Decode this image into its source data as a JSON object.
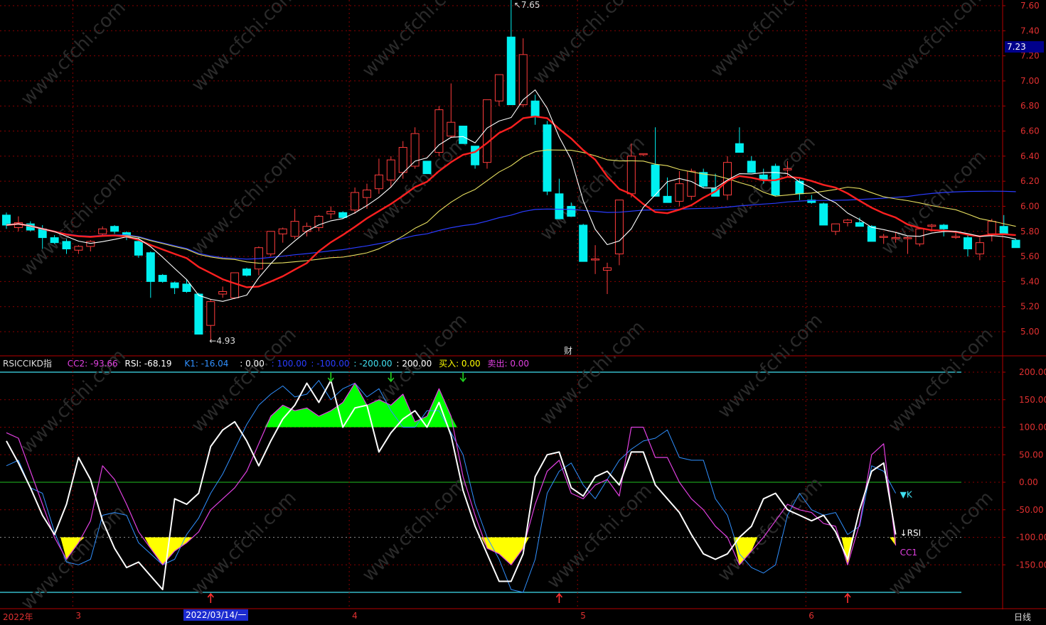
{
  "colors": {
    "up": "#ff3c3c",
    "down": "#00f0f0",
    "frame": "#b40000",
    "grid": "#8a0000",
    "ma_white": "#ffffff",
    "ma_red": "#ff2020",
    "ma_yellow": "#e8e060",
    "ma_blue": "#2a3cff",
    "cc_line": "#e040e0",
    "rsi_line": "#ffffff",
    "k_line": "#3090ff",
    "fill_green": "#00ff00",
    "fill_yellow": "#ffff00",
    "ref_cyan": "#40e0f0",
    "ref_green": "#20c020"
  },
  "header": {
    "indicator_name": "RSICCIKD指",
    "cc2": "CC2: -93.66",
    "rsi": "RSI: -68.19",
    "k1": "K1: -16.04",
    "v0": ": 0.00",
    "v100": ": 100.00",
    "vm100": ": -100.00",
    "vm200": ": -200.00",
    "v200": ": 200.00",
    "buy": "买入: 0.00",
    "sell": "卖出: 0.00"
  },
  "price_tag": "7.23",
  "timeframe": "日线",
  "selected_date": "2022/03/14/一",
  "fin_marker": "财",
  "line_labels": {
    "k": "▼K",
    "rsi": "↓RSI",
    "cc1": "CC1"
  },
  "extremes": {
    "high_label": "7.65",
    "low_label": "←4.93"
  },
  "chart_data": [
    {
      "type": "candlestick",
      "title": "",
      "ylim": [
        4.8,
        7.65
      ],
      "ytick_labels": [
        "7.60",
        "7.40",
        "7.20",
        "7.00",
        "6.80",
        "6.60",
        "6.40",
        "6.20",
        "6.00",
        "5.80",
        "5.60",
        "5.40",
        "5.20",
        "5.00"
      ],
      "ytick_values": [
        7.6,
        7.4,
        7.2,
        7.0,
        6.8,
        6.6,
        6.4,
        6.2,
        6.0,
        5.8,
        5.6,
        5.4,
        5.2,
        5.0
      ],
      "x_labels": [
        {
          "index": 0,
          "label": "2022年"
        },
        {
          "index": 6,
          "label": "3"
        },
        {
          "index": 29,
          "label": "4"
        },
        {
          "index": 48,
          "label": "5"
        },
        {
          "index": 67,
          "label": "6"
        }
      ],
      "ohlc": [
        [
          5.93,
          5.95,
          5.82,
          5.85
        ],
        [
          5.83,
          5.92,
          5.8,
          5.87
        ],
        [
          5.86,
          5.88,
          5.8,
          5.81
        ],
        [
          5.82,
          5.85,
          5.66,
          5.75
        ],
        [
          5.75,
          5.77,
          5.7,
          5.71
        ],
        [
          5.72,
          5.74,
          5.62,
          5.66
        ],
        [
          5.65,
          5.69,
          5.62,
          5.68
        ],
        [
          5.68,
          5.73,
          5.64,
          5.72
        ],
        [
          5.78,
          5.84,
          5.77,
          5.82
        ],
        [
          5.84,
          5.85,
          5.78,
          5.8
        ],
        [
          5.79,
          5.8,
          5.73,
          5.76
        ],
        [
          5.72,
          5.76,
          5.59,
          5.61
        ],
        [
          5.63,
          5.64,
          5.27,
          5.4
        ],
        [
          5.45,
          5.46,
          5.39,
          5.4
        ],
        [
          5.39,
          5.4,
          5.3,
          5.35
        ],
        [
          5.38,
          5.42,
          5.31,
          5.32
        ],
        [
          5.3,
          5.31,
          4.98,
          4.98
        ],
        [
          5.05,
          5.26,
          4.93,
          5.24
        ],
        [
          5.3,
          5.36,
          5.27,
          5.32
        ],
        [
          5.27,
          5.43,
          5.26,
          5.47
        ],
        [
          5.5,
          5.51,
          5.44,
          5.45
        ],
        [
          5.5,
          5.68,
          5.45,
          5.67
        ],
        [
          5.62,
          5.77,
          5.6,
          5.8
        ],
        [
          5.78,
          5.83,
          5.71,
          5.82
        ],
        [
          5.76,
          5.98,
          5.74,
          5.88
        ],
        [
          5.8,
          5.87,
          5.76,
          5.84
        ],
        [
          5.83,
          5.93,
          5.8,
          5.92
        ],
        [
          5.94,
          6.0,
          5.9,
          5.96
        ],
        [
          5.95,
          5.96,
          5.9,
          5.91
        ],
        [
          5.97,
          6.15,
          5.94,
          6.11
        ],
        [
          6.07,
          6.18,
          5.98,
          6.13
        ],
        [
          6.14,
          6.38,
          6.1,
          6.25
        ],
        [
          6.21,
          6.4,
          6.15,
          6.37
        ],
        [
          6.27,
          6.52,
          6.22,
          6.47
        ],
        [
          6.32,
          6.63,
          6.3,
          6.58
        ],
        [
          6.36,
          6.35,
          6.3,
          6.26
        ],
        [
          6.43,
          6.8,
          6.4,
          6.77
        ],
        [
          6.56,
          6.98,
          6.55,
          6.67
        ],
        [
          6.64,
          6.5,
          6.58,
          6.5
        ],
        [
          6.48,
          6.45,
          6.3,
          6.33
        ],
        [
          6.35,
          6.7,
          6.3,
          6.85
        ],
        [
          6.84,
          7.01,
          6.8,
          7.05
        ],
        [
          7.35,
          7.65,
          7.1,
          6.81
        ],
        [
          6.81,
          7.34,
          6.79,
          7.21
        ],
        [
          6.84,
          6.89,
          6.65,
          6.72
        ],
        [
          6.65,
          6.68,
          6.09,
          6.12
        ],
        [
          6.1,
          6.22,
          5.93,
          5.9
        ],
        [
          6.0,
          6.03,
          5.93,
          5.92
        ],
        [
          5.85,
          5.86,
          5.56,
          5.56
        ],
        [
          5.58,
          5.69,
          5.46,
          5.58
        ],
        [
          5.49,
          5.55,
          5.3,
          5.51
        ],
        [
          5.62,
          6.05,
          5.53,
          6.05
        ],
        [
          6.1,
          6.5,
          6.07,
          6.4
        ],
        [
          6.42,
          6.42,
          6.4,
          6.42
        ],
        [
          6.33,
          6.63,
          6.25,
          6.08
        ],
        [
          6.08,
          6.23,
          6.06,
          6.03
        ],
        [
          6.04,
          6.28,
          6.0,
          6.18
        ],
        [
          6.08,
          6.3,
          6.05,
          6.28
        ],
        [
          6.27,
          6.3,
          6.15,
          6.16
        ],
        [
          6.14,
          6.26,
          6.1,
          6.08
        ],
        [
          6.09,
          6.4,
          6.05,
          6.35
        ],
        [
          6.5,
          6.63,
          6.44,
          6.43
        ],
        [
          6.36,
          6.4,
          6.27,
          6.27
        ],
        [
          6.25,
          6.3,
          6.18,
          6.21
        ],
        [
          6.32,
          6.34,
          6.08,
          6.09
        ],
        [
          6.29,
          6.36,
          6.24,
          6.3
        ],
        [
          6.2,
          6.22,
          6.05,
          6.1
        ],
        [
          6.05,
          6.09,
          6.02,
          6.03
        ],
        [
          6.02,
          6.03,
          5.9,
          5.85
        ],
        [
          5.8,
          5.84,
          5.77,
          5.86
        ],
        [
          5.87,
          5.9,
          5.84,
          5.89
        ],
        [
          5.87,
          5.91,
          5.84,
          5.84
        ],
        [
          5.84,
          5.85,
          5.74,
          5.72
        ],
        [
          5.76,
          5.78,
          5.7,
          5.76
        ],
        [
          5.75,
          5.79,
          5.71,
          5.75
        ],
        [
          5.75,
          5.76,
          5.62,
          5.75
        ],
        [
          5.7,
          5.77,
          5.68,
          5.82
        ],
        [
          5.84,
          5.86,
          5.8,
          5.85
        ],
        [
          5.85,
          5.86,
          5.76,
          5.82
        ],
        [
          5.76,
          5.8,
          5.74,
          5.76
        ],
        [
          5.75,
          5.77,
          5.6,
          5.66
        ],
        [
          5.62,
          5.75,
          5.57,
          5.71
        ],
        [
          5.78,
          5.9,
          5.72,
          5.88
        ],
        [
          5.84,
          5.93,
          5.81,
          5.78
        ],
        [
          5.73,
          5.74,
          5.67,
          5.67
        ]
      ]
    },
    {
      "type": "line",
      "title": "",
      "ylim": [
        -220,
        210
      ],
      "ytick_labels": [
        "200.00",
        "150.00",
        "100.00",
        "50.00",
        "0.00",
        "-50.00",
        "-100.00",
        "-150.00"
      ],
      "ytick_values": [
        200,
        150,
        100,
        50,
        0,
        -50,
        -100,
        -150
      ],
      "reference_lines": [
        200,
        100,
        0,
        -100,
        -200
      ],
      "series": [
        {
          "name": "RSI",
          "values": [
            75,
            35,
            -10,
            -60,
            -95,
            -40,
            45,
            5,
            -70,
            -120,
            -155,
            -145,
            -170,
            -195,
            -30,
            -40,
            -20,
            65,
            95,
            110,
            75,
            30,
            75,
            115,
            140,
            180,
            145,
            185,
            100,
            135,
            140,
            55,
            90,
            115,
            130,
            100,
            145,
            85,
            -15,
            -80,
            -130,
            -180,
            -180,
            -130,
            10,
            50,
            55,
            -10,
            -25,
            10,
            20,
            -5,
            55,
            55,
            -5,
            -30,
            -55,
            -95,
            -130,
            -140,
            -130,
            -100,
            -80,
            -30,
            -20,
            -50,
            -60,
            -70,
            -60,
            -90,
            -140,
            -50,
            20,
            35,
            -95
          ]
        },
        {
          "name": "CC1",
          "values": [
            90,
            80,
            20,
            -40,
            -100,
            -140,
            -110,
            -70,
            30,
            5,
            -40,
            -90,
            -120,
            -150,
            -125,
            -110,
            -90,
            -50,
            -30,
            -10,
            20,
            70,
            120,
            140,
            130,
            135,
            120,
            130,
            145,
            180,
            140,
            150,
            140,
            160,
            110,
            120,
            170,
            120,
            10,
            -60,
            -120,
            -130,
            -150,
            -120,
            -40,
            20,
            40,
            -20,
            -30,
            -5,
            5,
            -25,
            100,
            100,
            45,
            45,
            0,
            -30,
            -50,
            -80,
            -100,
            -150,
            -125,
            -100,
            -70,
            -40,
            -50,
            -55,
            -75,
            -80,
            -150,
            -75,
            50,
            70,
            -115
          ]
        },
        {
          "name": "K",
          "values": [
            30,
            40,
            -10,
            -20,
            -90,
            -145,
            -150,
            -140,
            -60,
            -55,
            -60,
            -110,
            -130,
            -150,
            -140,
            -95,
            -65,
            -20,
            15,
            60,
            105,
            140,
            160,
            175,
            155,
            160,
            185,
            150,
            170,
            180,
            155,
            170,
            130,
            100,
            100,
            130,
            130,
            90,
            50,
            -40,
            -100,
            -140,
            -195,
            -200,
            -140,
            -20,
            20,
            35,
            -5,
            -30,
            5,
            40,
            60,
            75,
            80,
            95,
            45,
            40,
            40,
            -30,
            -60,
            -130,
            -155,
            -165,
            -150,
            -60,
            -20,
            -50,
            -60,
            -55,
            -95,
            -80,
            30,
            20,
            -20
          ]
        }
      ],
      "sell_arrows": [
        27,
        32,
        38
      ],
      "buy_arrows": [
        17,
        46,
        70
      ],
      "xlabel": "",
      "ylabel": ""
    }
  ]
}
